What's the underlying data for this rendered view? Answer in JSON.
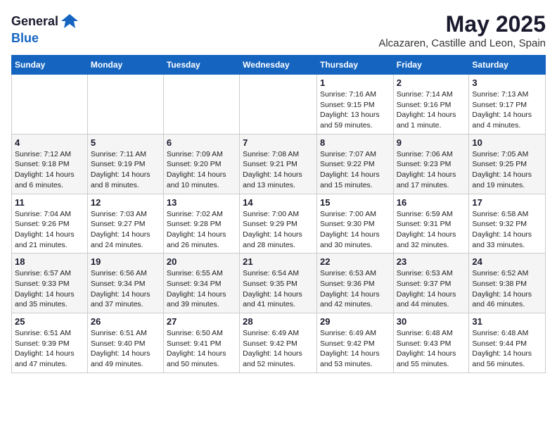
{
  "header": {
    "logo_general": "General",
    "logo_blue": "Blue",
    "main_title": "May 2025",
    "subtitle": "Alcazaren, Castille and Leon, Spain"
  },
  "days_of_week": [
    "Sunday",
    "Monday",
    "Tuesday",
    "Wednesday",
    "Thursday",
    "Friday",
    "Saturday"
  ],
  "weeks": [
    [
      {
        "day": "",
        "info": ""
      },
      {
        "day": "",
        "info": ""
      },
      {
        "day": "",
        "info": ""
      },
      {
        "day": "",
        "info": ""
      },
      {
        "day": "1",
        "info": "Sunrise: 7:16 AM\nSunset: 9:15 PM\nDaylight: 13 hours and 59 minutes."
      },
      {
        "day": "2",
        "info": "Sunrise: 7:14 AM\nSunset: 9:16 PM\nDaylight: 14 hours and 1 minute."
      },
      {
        "day": "3",
        "info": "Sunrise: 7:13 AM\nSunset: 9:17 PM\nDaylight: 14 hours and 4 minutes."
      }
    ],
    [
      {
        "day": "4",
        "info": "Sunrise: 7:12 AM\nSunset: 9:18 PM\nDaylight: 14 hours and 6 minutes."
      },
      {
        "day": "5",
        "info": "Sunrise: 7:11 AM\nSunset: 9:19 PM\nDaylight: 14 hours and 8 minutes."
      },
      {
        "day": "6",
        "info": "Sunrise: 7:09 AM\nSunset: 9:20 PM\nDaylight: 14 hours and 10 minutes."
      },
      {
        "day": "7",
        "info": "Sunrise: 7:08 AM\nSunset: 9:21 PM\nDaylight: 14 hours and 13 minutes."
      },
      {
        "day": "8",
        "info": "Sunrise: 7:07 AM\nSunset: 9:22 PM\nDaylight: 14 hours and 15 minutes."
      },
      {
        "day": "9",
        "info": "Sunrise: 7:06 AM\nSunset: 9:23 PM\nDaylight: 14 hours and 17 minutes."
      },
      {
        "day": "10",
        "info": "Sunrise: 7:05 AM\nSunset: 9:25 PM\nDaylight: 14 hours and 19 minutes."
      }
    ],
    [
      {
        "day": "11",
        "info": "Sunrise: 7:04 AM\nSunset: 9:26 PM\nDaylight: 14 hours and 21 minutes."
      },
      {
        "day": "12",
        "info": "Sunrise: 7:03 AM\nSunset: 9:27 PM\nDaylight: 14 hours and 24 minutes."
      },
      {
        "day": "13",
        "info": "Sunrise: 7:02 AM\nSunset: 9:28 PM\nDaylight: 14 hours and 26 minutes."
      },
      {
        "day": "14",
        "info": "Sunrise: 7:00 AM\nSunset: 9:29 PM\nDaylight: 14 hours and 28 minutes."
      },
      {
        "day": "15",
        "info": "Sunrise: 7:00 AM\nSunset: 9:30 PM\nDaylight: 14 hours and 30 minutes."
      },
      {
        "day": "16",
        "info": "Sunrise: 6:59 AM\nSunset: 9:31 PM\nDaylight: 14 hours and 32 minutes."
      },
      {
        "day": "17",
        "info": "Sunrise: 6:58 AM\nSunset: 9:32 PM\nDaylight: 14 hours and 33 minutes."
      }
    ],
    [
      {
        "day": "18",
        "info": "Sunrise: 6:57 AM\nSunset: 9:33 PM\nDaylight: 14 hours and 35 minutes."
      },
      {
        "day": "19",
        "info": "Sunrise: 6:56 AM\nSunset: 9:34 PM\nDaylight: 14 hours and 37 minutes."
      },
      {
        "day": "20",
        "info": "Sunrise: 6:55 AM\nSunset: 9:34 PM\nDaylight: 14 hours and 39 minutes."
      },
      {
        "day": "21",
        "info": "Sunrise: 6:54 AM\nSunset: 9:35 PM\nDaylight: 14 hours and 41 minutes."
      },
      {
        "day": "22",
        "info": "Sunrise: 6:53 AM\nSunset: 9:36 PM\nDaylight: 14 hours and 42 minutes."
      },
      {
        "day": "23",
        "info": "Sunrise: 6:53 AM\nSunset: 9:37 PM\nDaylight: 14 hours and 44 minutes."
      },
      {
        "day": "24",
        "info": "Sunrise: 6:52 AM\nSunset: 9:38 PM\nDaylight: 14 hours and 46 minutes."
      }
    ],
    [
      {
        "day": "25",
        "info": "Sunrise: 6:51 AM\nSunset: 9:39 PM\nDaylight: 14 hours and 47 minutes."
      },
      {
        "day": "26",
        "info": "Sunrise: 6:51 AM\nSunset: 9:40 PM\nDaylight: 14 hours and 49 minutes."
      },
      {
        "day": "27",
        "info": "Sunrise: 6:50 AM\nSunset: 9:41 PM\nDaylight: 14 hours and 50 minutes."
      },
      {
        "day": "28",
        "info": "Sunrise: 6:49 AM\nSunset: 9:42 PM\nDaylight: 14 hours and 52 minutes."
      },
      {
        "day": "29",
        "info": "Sunrise: 6:49 AM\nSunset: 9:42 PM\nDaylight: 14 hours and 53 minutes."
      },
      {
        "day": "30",
        "info": "Sunrise: 6:48 AM\nSunset: 9:43 PM\nDaylight: 14 hours and 55 minutes."
      },
      {
        "day": "31",
        "info": "Sunrise: 6:48 AM\nSunset: 9:44 PM\nDaylight: 14 hours and 56 minutes."
      }
    ]
  ]
}
